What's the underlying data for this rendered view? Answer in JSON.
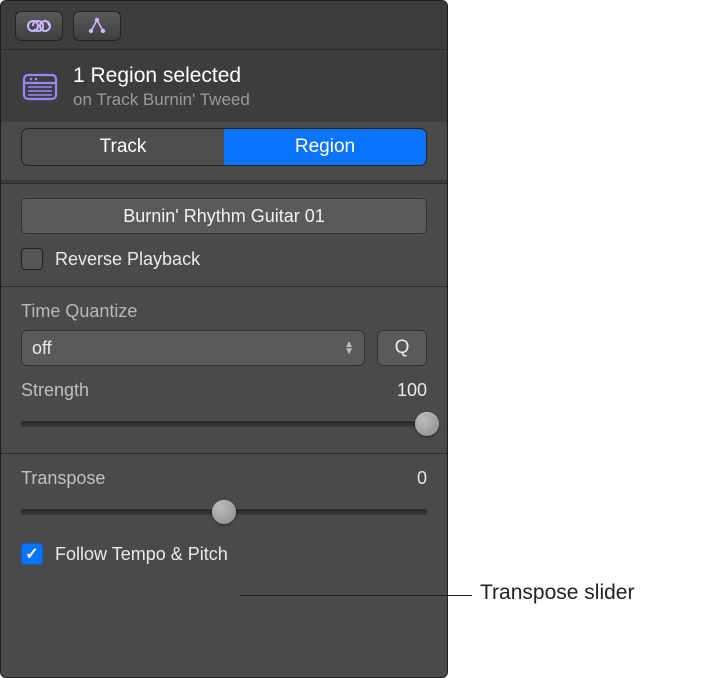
{
  "toolbar": {
    "loop_icon": "loop-icon",
    "link_icon": "link-icon"
  },
  "header": {
    "title": "1 Region selected",
    "subtitle": "on Track Burnin' Tweed"
  },
  "segmented": {
    "track_label": "Track",
    "region_label": "Region"
  },
  "region": {
    "name": "Burnin' Rhythm Guitar 01",
    "reverse_playback_label": "Reverse Playback",
    "reverse_playback_checked": false
  },
  "quantize": {
    "label": "Time Quantize",
    "value": "off",
    "q_button": "Q",
    "strength_label": "Strength",
    "strength_value": "100",
    "strength_pct": 100
  },
  "transpose": {
    "label": "Transpose",
    "value": "0",
    "slider_pct": 50,
    "follow_label": "Follow Tempo & Pitch",
    "follow_checked": true
  },
  "annotation": {
    "transpose_slider": "Transpose slider"
  }
}
